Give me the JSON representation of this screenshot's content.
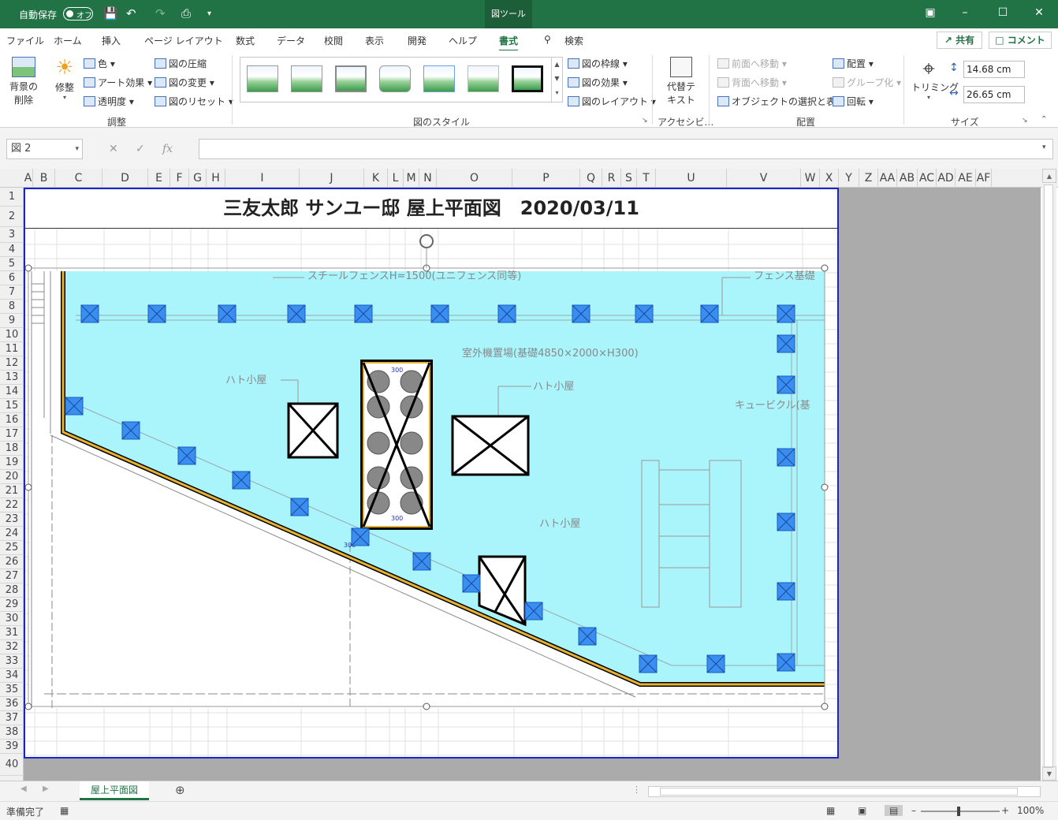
{
  "titlebar": {
    "autosave_label": "自動保存",
    "autosave_state": "オフ",
    "tool_tab": "図ツール"
  },
  "menu_tabs": [
    {
      "label": "ファイル"
    },
    {
      "label": "ホーム"
    },
    {
      "label": "挿入"
    },
    {
      "label": "ページ レイアウト"
    },
    {
      "label": "数式"
    },
    {
      "label": "データ"
    },
    {
      "label": "校閲"
    },
    {
      "label": "表示"
    },
    {
      "label": "開発"
    },
    {
      "label": "ヘルプ"
    },
    {
      "label": "書式"
    }
  ],
  "search_label": "検索",
  "share_label": "共有",
  "comment_label": "コメント",
  "ribbon": {
    "remove_bg": [
      "背景の",
      "削除"
    ],
    "corrections": "修整",
    "color": "色",
    "artistic": "アート効果",
    "transparency": "透明度",
    "compress": "図の圧縮",
    "change": "図の変更",
    "reset": "図のリセット",
    "group_adjust": "調整",
    "group_styles": "図のスタイル",
    "border": "図の枠線",
    "effects": "図の効果",
    "layout": "図のレイアウト",
    "alt_text": [
      "代替テ",
      "キスト"
    ],
    "group_access": "アクセシビ…",
    "bring_forward": "前面へ移動",
    "send_backward": "背面へ移動",
    "selection_pane": "オブジェクトの選択と表示",
    "align": "配置",
    "group": "グループ化",
    "rotate": "回転",
    "group_arrange": "配置",
    "crop": "トリミング",
    "height": "14.68 cm",
    "width": "26.65 cm",
    "group_size": "サイズ"
  },
  "formula": {
    "name_box": "図 2",
    "fx": "fx",
    "value": ""
  },
  "columns": [
    "A",
    "B",
    "C",
    "D",
    "E",
    "F",
    "G",
    "H",
    "I",
    "J",
    "K",
    "L",
    "M",
    "N",
    "O",
    "P",
    "Q",
    "R",
    "S",
    "T",
    "U",
    "V",
    "W",
    "X",
    "Y",
    "Z",
    "AA",
    "AB",
    "AC",
    "AD",
    "AE",
    "AF"
  ],
  "rows": [
    "1",
    "2",
    "3",
    "4",
    "5",
    "6",
    "7",
    "8",
    "9",
    "10",
    "11",
    "12",
    "13",
    "14",
    "15",
    "16",
    "17",
    "18",
    "19",
    "20",
    "21",
    "22",
    "23",
    "24",
    "25",
    "26",
    "27",
    "28",
    "29",
    "30",
    "31",
    "32",
    "33",
    "34",
    "35",
    "36",
    "37",
    "38",
    "39",
    "40"
  ],
  "sheet_title": "三友太郎 サンユー邸 屋上平面図　2020/03/11",
  "drawing": {
    "fence_label": "スチールフェンスH=1500(ユニフェンス同等)",
    "fence_base_label": "フェンス基礎",
    "outdoor_unit_label": "室外機置場(基礎4850×2000×H300)",
    "hut_label_1": "ハト小屋",
    "hut_label_2": "ハト小屋",
    "hut_label_3": "ハト小屋",
    "cubicle_label": "キュービクル(基",
    "dim_300": "300"
  },
  "sheet_tab": "屋上平面図",
  "status": {
    "ready": "準備完了",
    "zoom": "100%"
  },
  "colors": {
    "accent": "#217346",
    "roof_fill": "#aaf4fc",
    "marker": "#3a8ef0",
    "print_border": "#1826c8"
  }
}
